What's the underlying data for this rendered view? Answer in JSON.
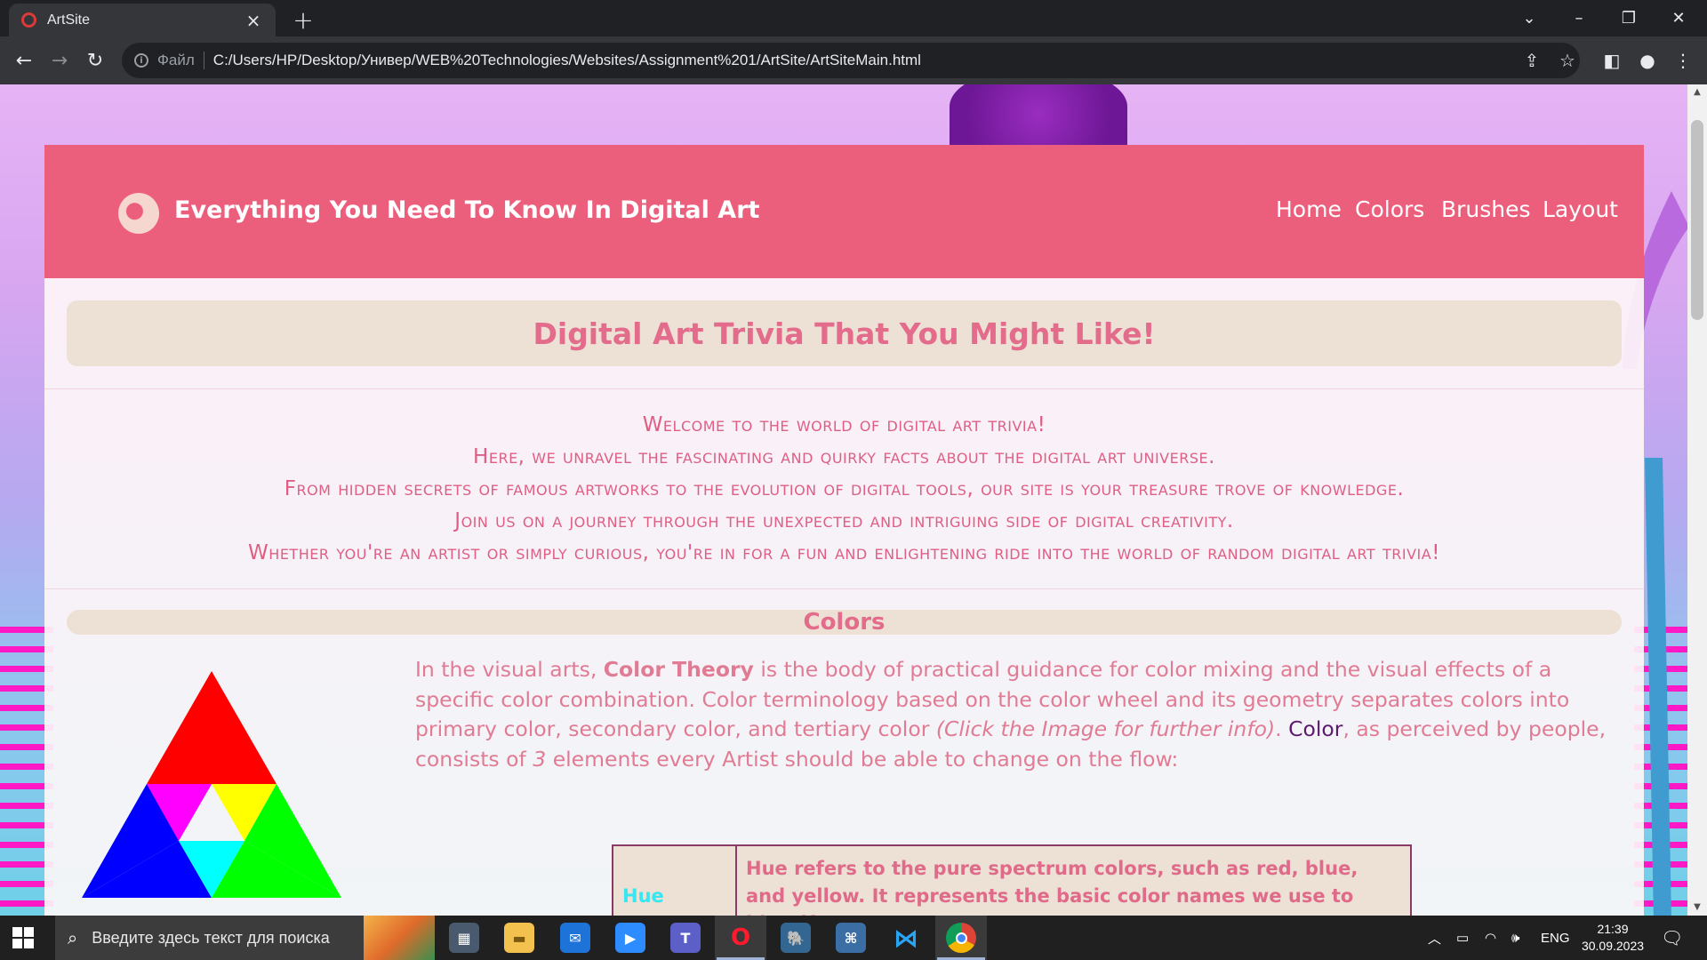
{
  "browser": {
    "tab_title": "ArtSite",
    "file_label": "Файл",
    "url": "C:/Users/HP/Desktop/Универ/WEB%20Technologies/Websites/Assignment%201/ArtSite/ArtSiteMain.html"
  },
  "site": {
    "title": "Everything You Need To Know In Digital Art",
    "nav": [
      "Home",
      "Colors",
      "Brushes",
      "Layout"
    ],
    "trivia_heading": "Digital Art Trivia That You Might Like!",
    "welcome_lines": [
      "Welcome to the world of digital art trivia!",
      "Here, we unravel the fascinating and quirky facts about the digital art universe.",
      "From hidden secrets of famous artworks to the evolution of digital tools, our site is your treasure trove of knowledge.",
      "Join us on a journey through the unexpected and intriguing side of digital creativity.",
      "Whether you're an artist or simply curious, you're in for a fun and enlightening ride into the world of random digital art trivia!"
    ],
    "colors_section": {
      "heading": "Colors",
      "para_1": "In the visual arts, ",
      "para_bold": "Color Theory",
      "para_2": " is the body of practical guidance for color mixing and the visual effects of a specific color combination. Color terminology based on the color wheel and its geometry separates colors into primary color, secondary color, and tertiary color ",
      "para_italic": "(Click the Image for further info)",
      "para_3": ". ",
      "para_link": "Color",
      "para_4": ", as perceived by people, consists of ",
      "para_number": "3",
      "para_5": " elements every Artist should be able to change on the flow:",
      "table": {
        "term": "Hue",
        "definition": "Hue refers to the pure spectrum colors, such as red, blue, and yellow. It represents the basic color names we use to identify"
      }
    }
  },
  "taskbar": {
    "search_placeholder": "Введите здесь текст для поиска",
    "language": "ENG",
    "time": "21:39",
    "date": "30.09.2023"
  }
}
